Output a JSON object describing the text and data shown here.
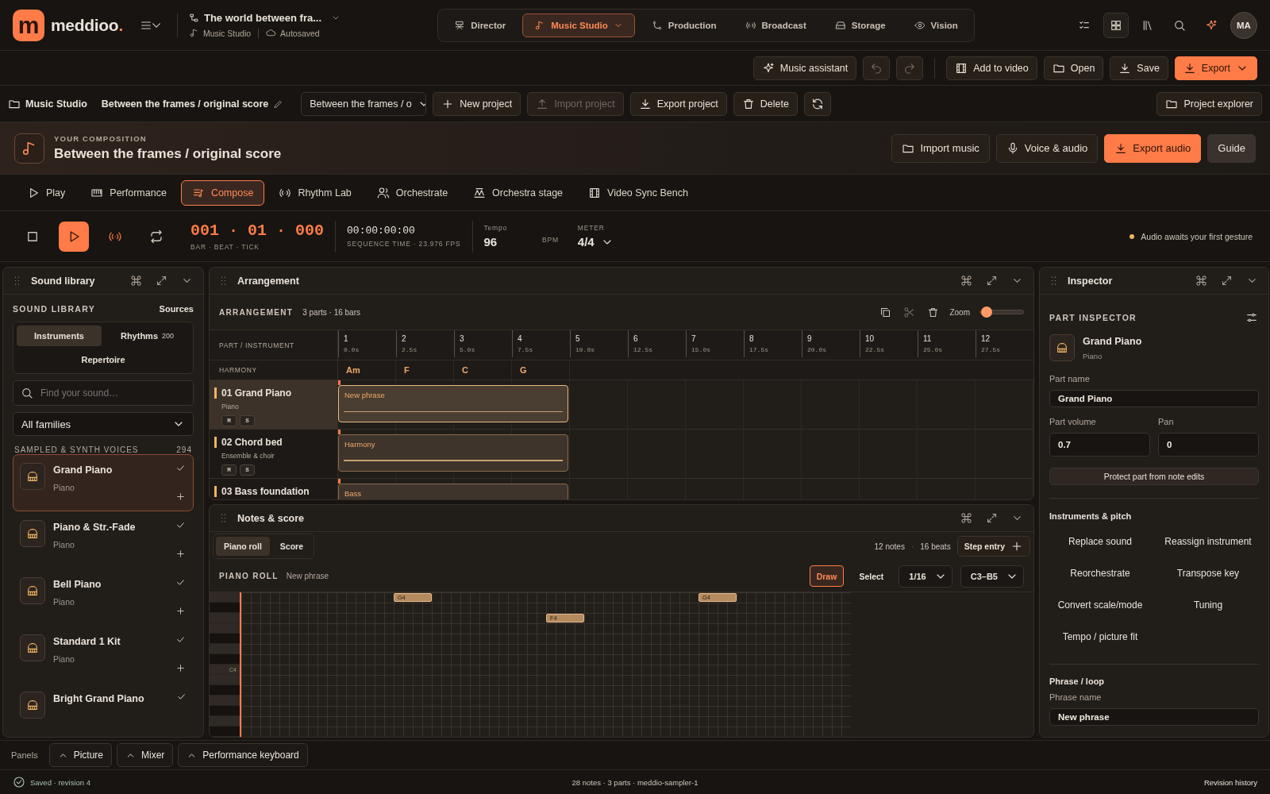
{
  "topbar": {
    "logo_mark": "m",
    "logo": "meddioo.",
    "project_title": "The world between fra...",
    "breadcrumb": "Music Studio",
    "save_state": "Autosaved",
    "modules": [
      {
        "label": "Director",
        "selected": false
      },
      {
        "label": "Music Studio",
        "selected": true
      },
      {
        "label": "Production",
        "selected": false
      },
      {
        "label": "Broadcast",
        "selected": false
      },
      {
        "label": "Storage",
        "selected": false
      },
      {
        "label": "Vision",
        "selected": false
      }
    ],
    "avatar": "MA"
  },
  "actions": [
    {
      "label": "Music assistant",
      "disabled": false
    },
    {
      "disabled": true
    },
    {
      "disabled": true
    },
    {
      "label": "Add to video",
      "disabled": false
    },
    {
      "label": "Open",
      "disabled": false
    },
    {
      "label": "Save",
      "disabled": false
    },
    {
      "label": "Export",
      "disabled": false
    }
  ],
  "project_bar": {
    "section": "Music Studio",
    "title": "Between the frames / original score",
    "project_select": "Between the frames / o",
    "buttons": [
      {
        "label": "New project",
        "disabled": false
      },
      {
        "label": "Import project",
        "disabled": true
      },
      {
        "label": "Export project",
        "disabled": false
      },
      {
        "label": "Delete",
        "disabled": false
      }
    ],
    "explorer": "Project explorer"
  },
  "composition": {
    "eyebrow": "YOUR COMPOSITION",
    "title": "Between the frames / original score",
    "buttons": [
      "Import music",
      "Voice & audio",
      "Export audio",
      "Guide"
    ]
  },
  "modes": [
    {
      "label": "Play",
      "selected": false
    },
    {
      "label": "Performance",
      "selected": false
    },
    {
      "label": "Compose",
      "selected": true
    },
    {
      "label": "Rhythm Lab",
      "selected": false
    },
    {
      "label": "Orchestrate",
      "selected": false
    },
    {
      "label": "Orchestra stage",
      "selected": false
    },
    {
      "label": "Video Sync Bench",
      "selected": false
    }
  ],
  "transport": {
    "controls": [
      {
        "active": false
      },
      {
        "active": true
      },
      {
        "active": true
      },
      {
        "active": false
      }
    ],
    "position": "001 · 01 · 000",
    "position_label": "BAR · BEAT · TICK",
    "timecode": "00:00:00:00",
    "timecode_label": "SEQUENCE TIME · 23.976 FPS",
    "tempo_label": "Tempo",
    "tempo": "96",
    "tempo_unit": "BPM",
    "meter_label": "METER",
    "meter": "4/4",
    "status": "Audio awaits your first gesture"
  },
  "sound_library": {
    "panel_title": "Sound library",
    "heading": "SOUND LIBRARY",
    "sources": "Sources",
    "tabs": [
      {
        "label": "Instruments",
        "selected": true
      },
      {
        "label": "Rhythms",
        "count": "200",
        "selected": false
      },
      {
        "label": "Repertoire",
        "selected": false
      }
    ],
    "search": {
      "placeholder": "Find your sound…"
    },
    "family_select": "All families",
    "section": "SAMPLED & SYNTH VOICES",
    "section_count": "294",
    "items": [
      {
        "name": "Grand Piano",
        "family": "Piano",
        "selected": true
      },
      {
        "name": "Piano & Str.-Fade",
        "family": "Piano",
        "selected": false
      },
      {
        "name": "Bell Piano",
        "family": "Piano",
        "selected": false
      },
      {
        "name": "Standard 1 Kit",
        "family": "Piano",
        "selected": false
      },
      {
        "name": "Bright Grand Piano",
        "selected": false
      }
    ]
  },
  "arrangement": {
    "panel_title": "Arrangement",
    "heading": "ARRANGEMENT",
    "summary": "3 parts · 16 bars",
    "zoom_label": "Zoom",
    "zoom": {
      "level": 0.15
    },
    "part_column": "PART / INSTRUMENT",
    "harmony_label": "HARMONY",
    "bars": [
      {
        "number": "1",
        "time": "0.0s"
      },
      {
        "number": "2",
        "time": "2.5s"
      },
      {
        "number": "3",
        "time": "5.0s"
      },
      {
        "number": "4",
        "time": "7.5s"
      },
      {
        "number": "5",
        "time": "10.0s"
      },
      {
        "number": "6",
        "time": "12.5s"
      },
      {
        "number": "7",
        "time": "15.0s"
      },
      {
        "number": "8",
        "time": "17.5s"
      },
      {
        "number": "9",
        "time": "20.0s"
      },
      {
        "number": "10",
        "time": "22.5s"
      },
      {
        "number": "11",
        "time": "25.0s"
      },
      {
        "number": "12",
        "time": "27.5s"
      }
    ],
    "chords": [
      "Am",
      "F",
      "C",
      "G"
    ],
    "tracks": [
      {
        "name": "01 Grand Piano",
        "instrument": "Piano",
        "buttons": [
          "M",
          "S"
        ],
        "selected": true,
        "clip": {
          "label": "New phrase",
          "selected": true
        }
      },
      {
        "name": "02 Chord bed",
        "instrument": "Ensemble & choir",
        "buttons": [
          "M",
          "S"
        ],
        "selected": false,
        "clip": {
          "label": "Harmony",
          "selected": false
        }
      },
      {
        "name": "03 Bass foundation",
        "selected": false,
        "clip": {
          "label": "Bass",
          "selected": false
        }
      }
    ]
  },
  "notes": {
    "panel_title": "Notes & score",
    "tabs": [
      {
        "label": "Piano roll",
        "selected": true
      },
      {
        "label": "Score",
        "selected": false
      }
    ],
    "note_count": "12 notes",
    "separator": "·",
    "beat_count": "16 beats",
    "step_entry": "Step entry",
    "heading": "PIANO ROLL",
    "phrase": "New phrase",
    "tools": [
      {
        "label": "Draw",
        "selected": true
      },
      {
        "label": "Select",
        "selected": false
      }
    ],
    "grid_select": "1/16",
    "range_select": "C3–B5",
    "keys": [
      {
        "black": false
      },
      {
        "black": true
      },
      {
        "black": false
      },
      {
        "black": false
      },
      {
        "black": true
      },
      {
        "black": false
      },
      {
        "black": true
      },
      {
        "black": false,
        "label": "C4"
      },
      {
        "black": false
      },
      {
        "black": true
      },
      {
        "black": false
      },
      {
        "black": true
      },
      {
        "black": false
      },
      {
        "black": true
      }
    ],
    "piano_notes": [
      {
        "label": "G4"
      },
      {
        "label": "F4"
      },
      {
        "label": "G4"
      }
    ]
  },
  "inspector": {
    "panel_title": "Inspector",
    "heading": "PART INSPECTOR",
    "part": "Grand Piano",
    "family": "Piano",
    "part_name_label": "Part name",
    "part_name": "Grand Piano",
    "volume_label": "Part volume",
    "volume": "0.7",
    "pan_label": "Pan",
    "pan": "0",
    "protect": "Protect part from note edits",
    "pitch_section": "Instruments & pitch",
    "pitch_actions": [
      "Replace sound",
      "Reassign instrument",
      "Reorchestrate",
      "Transpose key",
      "Convert scale/mode",
      "Tuning",
      "Tempo / picture fit"
    ],
    "phrase_section": "Phrase / loop",
    "phrase_name_label": "Phrase name",
    "phrase_name": "New phrase"
  },
  "panels_bar": {
    "label": "Panels",
    "buttons": [
      "Picture",
      "Mixer",
      "Performance keyboard"
    ]
  },
  "status_bar": {
    "saved": "Saved · revision 4",
    "summary": "28 notes · 3 parts · meddio-sampler-1",
    "history": "Revision history"
  }
}
